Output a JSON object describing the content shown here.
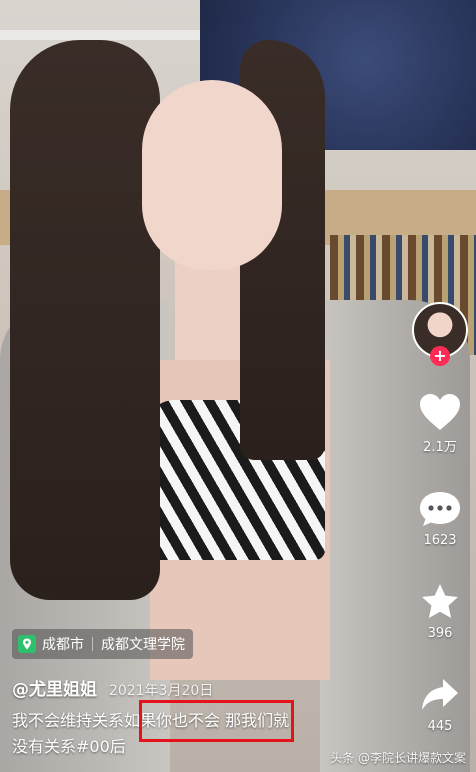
{
  "author": {
    "handle": "@尤里姐姐",
    "date": "2021年3月20日"
  },
  "location": {
    "city": "成都市",
    "place": "成都文理学院"
  },
  "caption": {
    "line1_a": "我不会维持关系",
    "line1_b": "如果你也不会 那我们就",
    "line2": "没有关系#00后"
  },
  "actions": {
    "likes": "2.1万",
    "comments": "1623",
    "favorites": "396",
    "shares": "445",
    "follow_symbol": "+"
  },
  "watermark": "头条 @李院长讲爆款文案",
  "colors": {
    "follow_red": "#fe2c55",
    "highlight_red": "#e3121b"
  }
}
